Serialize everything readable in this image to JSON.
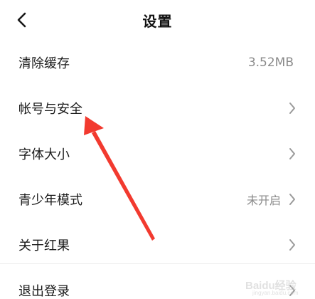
{
  "header": {
    "title": "设置",
    "back_icon": "chevron-left-icon"
  },
  "settings": {
    "items": [
      {
        "label": "清除缓存",
        "value": "3.52MB",
        "has_chevron": false
      },
      {
        "label": "帐号与安全",
        "value": "",
        "has_chevron": true
      },
      {
        "label": "字体大小",
        "value": "",
        "has_chevron": true
      },
      {
        "label": "青少年模式",
        "value": "未开启",
        "has_chevron": true
      },
      {
        "label": "关于红果",
        "value": "",
        "has_chevron": true
      },
      {
        "label": "退出登录",
        "value": "",
        "has_chevron": true
      }
    ]
  },
  "colors": {
    "annotation_arrow": "#f23a2f",
    "secondary_text": "#8a8a8a",
    "chevron": "#9a9a9a"
  },
  "watermark": {
    "brand": "Baidu经验",
    "url": "jingyan.baidu.com"
  }
}
